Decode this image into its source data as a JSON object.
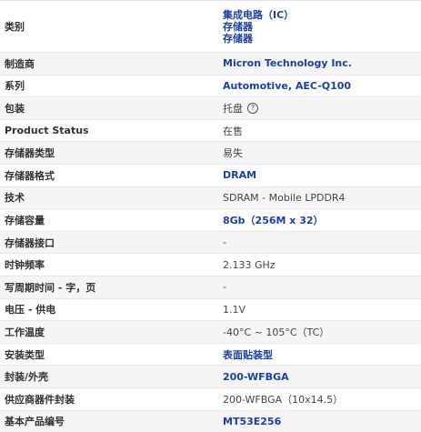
{
  "rows": [
    {
      "label": "类别",
      "values": [
        "集成电路（IC）",
        "存储器",
        "存储器"
      ]
    },
    {
      "label": "制造商",
      "value": "Micron Technology Inc."
    },
    {
      "label": "系列",
      "value": "Automotive, AEC-Q100"
    },
    {
      "label": "包装",
      "value": "托盘",
      "icon": "help-icon"
    },
    {
      "label": "Product Status",
      "value": "在售"
    },
    {
      "label": "存储器类型",
      "value": "易失"
    },
    {
      "label": "存储器格式",
      "value": "DRAM"
    },
    {
      "label": "技术",
      "value": "SDRAM - Mobile LPDDR4"
    },
    {
      "label": "存储容量",
      "value": "8Gb（256M x 32）"
    },
    {
      "label": "存储器接口",
      "value": "-"
    },
    {
      "label": "时钟频率",
      "value": "2.133 GHz"
    },
    {
      "label": "写周期时间 - 字，页",
      "value": "-"
    },
    {
      "label": "电压 - 供电",
      "value": "1.1V"
    },
    {
      "label": "工作温度",
      "value": "-40°C ~ 105°C（TC）"
    },
    {
      "label": "安装类型",
      "value": "表面贴装型"
    },
    {
      "label": "封装/外壳",
      "value": "200-WFBGA"
    },
    {
      "label": "供应商器件封装",
      "value": "200-WFBGA（10x14.5）"
    },
    {
      "label": "基本产品编号",
      "value": "MT53E256"
    }
  ],
  "colors": {
    "link": "#1a3fa6",
    "alt_row": "#f5f5f5",
    "border": "#e6e6e6"
  }
}
